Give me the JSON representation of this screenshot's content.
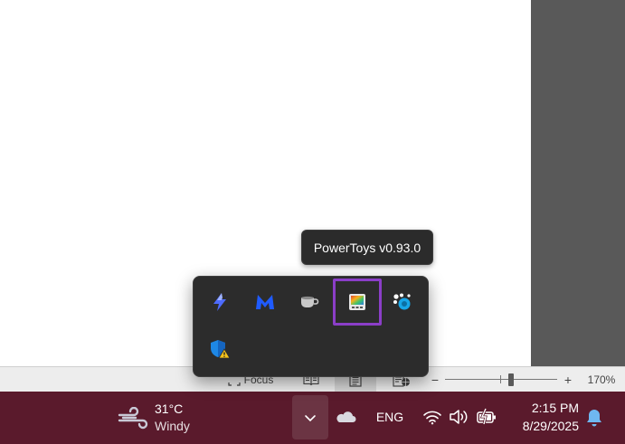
{
  "tooltip": {
    "text": "PowerToys v0.93.0"
  },
  "tray": {
    "icons": [
      {
        "icon": "lightning-bolt-icon"
      },
      {
        "icon": "malwarebytes-icon"
      },
      {
        "icon": "coffee-cup-icon"
      },
      {
        "icon": "powertoys-icon",
        "highlight_color": "#8b3ec8"
      },
      {
        "icon": "paint-drops-icon"
      },
      {
        "icon": "security-shield-warning-icon"
      }
    ]
  },
  "status_bar": {
    "focus_label": "Focus",
    "zoom_minus": "−",
    "zoom_plus": "+",
    "zoom_level": "170%",
    "zoom_value_percent": 170
  },
  "taskbar": {
    "color": "#5a1a2c",
    "weather": {
      "temp": "31°C",
      "condition": "Windy"
    },
    "language": "ENG",
    "time": "2:15 PM",
    "date": "8/29/2025"
  }
}
